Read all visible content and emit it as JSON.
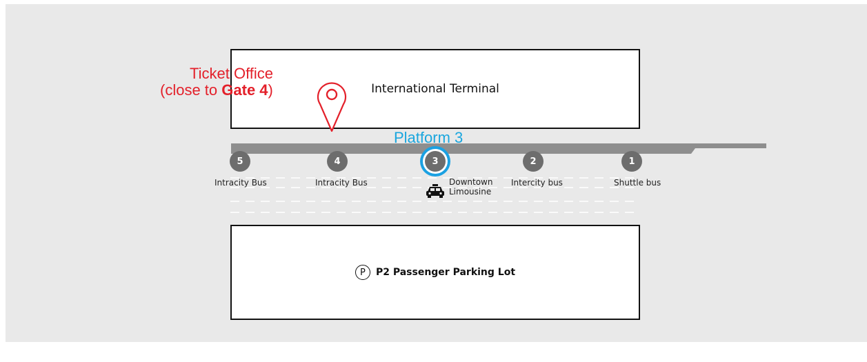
{
  "terminal": {
    "label": "International Terminal"
  },
  "parking": {
    "label": "P2 Passenger Parking Lot",
    "icon_letter": "P"
  },
  "platform": {
    "label": "Platform 3",
    "color": "#1aa6de"
  },
  "ticket_office": {
    "line1": "Ticket Office",
    "line2_prefix": "(close to ",
    "line2_bold": "Gate 4",
    "line2_suffix": ")",
    "color": "#e3202a",
    "icon": "location-pin-icon"
  },
  "gates": [
    {
      "number": "5",
      "label": "Intracity Bus"
    },
    {
      "number": "4",
      "label": "Intracity Bus"
    },
    {
      "number": "3",
      "label_line1": "Downtown",
      "label_line2": "Limousine",
      "icon": "taxi-icon",
      "highlighted": true
    },
    {
      "number": "2",
      "label": "Intercity bus"
    },
    {
      "number": "1",
      "label": "Shuttle bus"
    }
  ]
}
